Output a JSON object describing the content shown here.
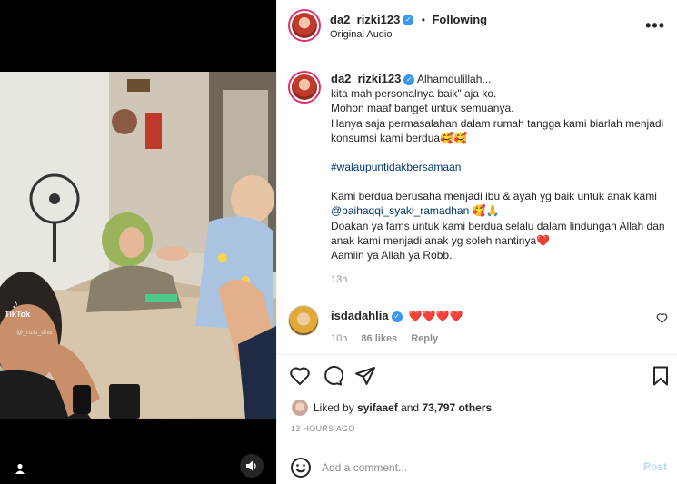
{
  "post": {
    "username": "da2_rizki123",
    "follow_status": "Following",
    "dot": "•",
    "audio": "Original Audio",
    "more": "•••",
    "verified_mark": "✓"
  },
  "caption": {
    "username": "da2_rizki123",
    "line1": "Alhamdulillah...",
    "line2": "kita mah personalnya baik\" aja ko.",
    "line3": "Mohon maaf banget untuk semuanya.",
    "line4": "Hanya saja permasalahan dalam rumah tangga kami biarlah menjadi konsumsi kami berdua🥰🥰",
    "hashtag": "#walaupuntidakbersamaan",
    "line5": "Kami berdua berusaha menjadi ibu & ayah yg baik untuk anak kami",
    "mention": "@baihaqqi_syaki_ramadhan",
    "mention_emoji": " 🥰🙏",
    "line6": "Doakan ya fams untuk kami berdua selalu dalam lindungan Allah dan anak kami menjadi anak yg soleh nantinya❤️",
    "line7": "Aamiin ya Allah ya Robb.",
    "time": "13h"
  },
  "comment": {
    "username": "isdadahlia",
    "text": "❤️❤️❤️❤️",
    "time": "10h",
    "likes": "86 likes",
    "reply": "Reply"
  },
  "likes": {
    "prefix": "Liked by ",
    "user": "syifaaef",
    "middle": " and ",
    "count": "73,797 others"
  },
  "timestamp": "13 HOURS AGO",
  "add_comment": {
    "placeholder": "Add a comment...",
    "post_label": "Post"
  },
  "video": {
    "watermark": "TikTok",
    "watermark_user": "@_rizki_dha"
  },
  "icons": {
    "heart": "heart-icon",
    "comment": "comment-icon",
    "share": "share-icon",
    "save": "bookmark-icon",
    "emoji": "emoji-icon",
    "sound": "speaker-icon",
    "user": "user-tag-icon"
  },
  "colors": {
    "link": "#00376b",
    "verified": "#3897f0",
    "muted": "#8e8e8e",
    "post_disabled": "#b3dbff"
  }
}
